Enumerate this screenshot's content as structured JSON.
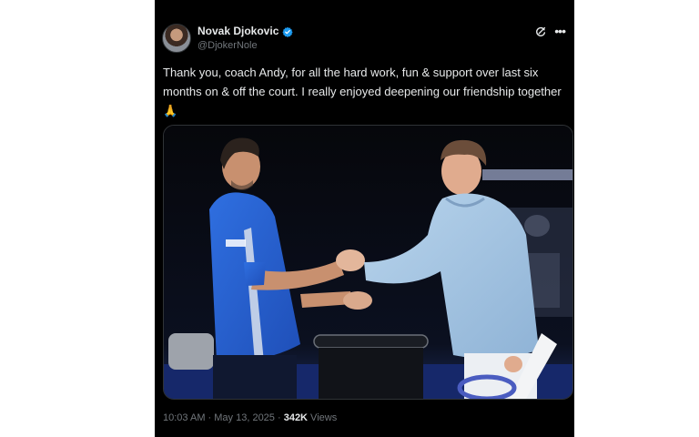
{
  "top_fragment": "· · ·",
  "author": {
    "display_name": "Novak Djokovic",
    "handle": "@DjokerNole",
    "verified": true
  },
  "tweet": {
    "text": "Thank you, coach Andy, for all the hard work, fun & support over last six months on & off the court. I really enjoyed deepening our friendship together 🙏"
  },
  "media": {
    "alt_label": "photo"
  },
  "meta": {
    "time": "10:03 AM",
    "separator": " · ",
    "date": "May 13, 2025",
    "views_count": "342K",
    "views_label": " Views"
  },
  "colors": {
    "background": "#000000",
    "text": "#e7e9ea",
    "muted": "#71767b",
    "verified": "#1d9bf0",
    "border": "#2f3336"
  },
  "icons": [
    "verified-badge-icon",
    "grok-icon",
    "more-options-icon"
  ]
}
